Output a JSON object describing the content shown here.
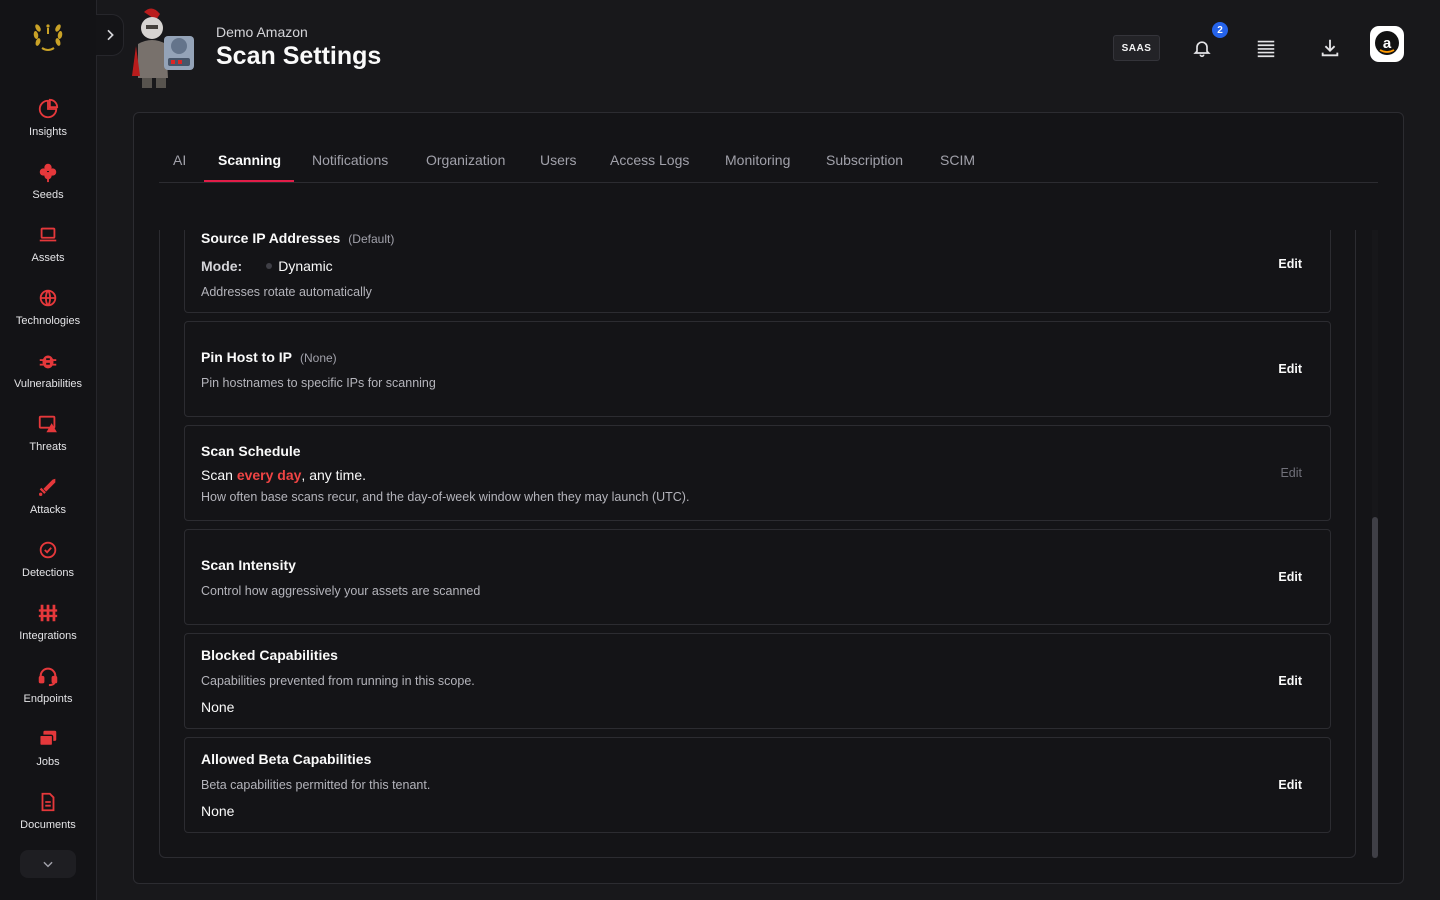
{
  "sidebar": {
    "items": [
      {
        "label": "Insights",
        "icon": "pie-chart-icon"
      },
      {
        "label": "Seeds",
        "icon": "seed-icon"
      },
      {
        "label": "Assets",
        "icon": "laptop-icon"
      },
      {
        "label": "Technologies",
        "icon": "globe-icon"
      },
      {
        "label": "Vulnerabilities",
        "icon": "bug-icon"
      },
      {
        "label": "Threats",
        "icon": "threat-icon"
      },
      {
        "label": "Attacks",
        "icon": "sword-icon"
      },
      {
        "label": "Detections",
        "icon": "check-circle-icon"
      },
      {
        "label": "Integrations",
        "icon": "integrations-icon"
      },
      {
        "label": "Endpoints",
        "icon": "headset-icon"
      },
      {
        "label": "Jobs",
        "icon": "jobs-icon"
      },
      {
        "label": "Documents",
        "icon": "document-icon"
      }
    ],
    "accent_color": "#e5383b"
  },
  "header": {
    "account": "Demo Amazon",
    "title": "Scan Settings",
    "badge": "SAAS",
    "notification_count": "2",
    "avatar_letter": "a"
  },
  "tabs": [
    {
      "label": "AI"
    },
    {
      "label": "Scanning",
      "active": true
    },
    {
      "label": "Notifications"
    },
    {
      "label": "Organization"
    },
    {
      "label": "Users"
    },
    {
      "label": "Access Logs"
    },
    {
      "label": "Monitoring"
    },
    {
      "label": "Subscription"
    },
    {
      "label": "SCIM"
    }
  ],
  "cards": {
    "source_ip": {
      "title": "Source IP Addresses",
      "tag": "(Default)",
      "mode_label": "Mode:",
      "mode_value": "Dynamic",
      "desc": "Addresses rotate automatically",
      "edit": "Edit"
    },
    "pin_host": {
      "title": "Pin Host to IP",
      "tag": "(None)",
      "desc": "Pin hostnames to specific IPs for scanning",
      "edit": "Edit"
    },
    "schedule": {
      "title": "Scan Schedule",
      "value_prefix": "Scan ",
      "value_accent": "every day",
      "value_suffix": ", any time.",
      "desc": "How often base scans recur, and the day-of-week window when they may launch (UTC).",
      "edit": "Edit"
    },
    "intensity": {
      "title": "Scan Intensity",
      "desc": "Control how aggressively your assets are scanned",
      "edit": "Edit"
    },
    "blocked": {
      "title": "Blocked Capabilities",
      "desc": "Capabilities prevented from running in this scope.",
      "value": "None",
      "edit": "Edit"
    },
    "beta": {
      "title": "Allowed Beta Capabilities",
      "desc": "Beta capabilities permitted for this tenant.",
      "value": "None",
      "edit": "Edit"
    }
  }
}
